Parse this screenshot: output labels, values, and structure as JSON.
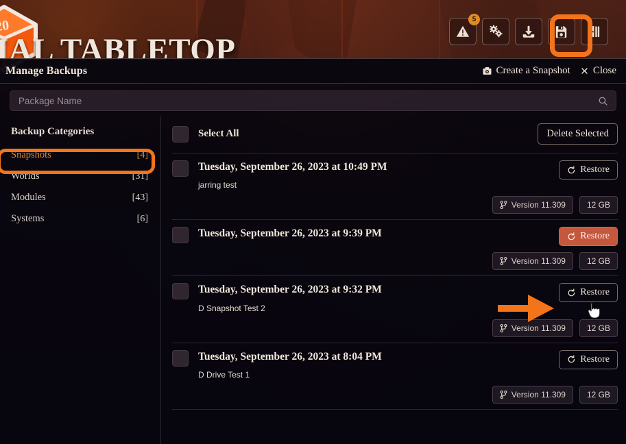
{
  "app": {
    "brand_title": "IAL TABLETOP",
    "logo_icon": "d20-die-icon"
  },
  "toolbar": {
    "items": [
      {
        "name": "warnings-button",
        "icon": "warning-triangle-icon",
        "badge": "5"
      },
      {
        "name": "configuration-button",
        "icon": "gears-icon",
        "badge": ""
      },
      {
        "name": "update-button",
        "icon": "download-icon",
        "badge": ""
      },
      {
        "name": "backups-button",
        "icon": "save-floppy-icon",
        "badge": ""
      },
      {
        "name": "logout-button",
        "icon": "door-exit-icon",
        "badge": ""
      }
    ]
  },
  "dialog": {
    "title": "Manage Backups",
    "create_snapshot_label": "Create a Snapshot",
    "create_snapshot_icon": "camera-icon",
    "close_label": "Close",
    "close_icon": "close-x-icon"
  },
  "search": {
    "placeholder": "Package Name",
    "value": "",
    "icon": "search-icon"
  },
  "sidebar": {
    "heading": "Backup Categories",
    "items": [
      {
        "label": "Snapshots",
        "count": "[4]",
        "active": true
      },
      {
        "label": "Worlds",
        "count": "[31]",
        "active": false
      },
      {
        "label": "Modules",
        "count": "[43]",
        "active": false
      },
      {
        "label": "Systems",
        "count": "[6]",
        "active": false
      }
    ]
  },
  "list_toolbar": {
    "select_all_label": "Select All",
    "delete_selected_label": "Delete Selected"
  },
  "backups": [
    {
      "date": "Tuesday, September 26, 2023 at 10:49 PM",
      "note": "jarring test",
      "restore_label": "Restore",
      "restore_icon": "restore-rotate-icon",
      "version": "Version 11.309",
      "version_icon": "code-branch-icon",
      "size": "12 GB",
      "hovered": false
    },
    {
      "date": "Tuesday, September 26, 2023 at 9:39 PM",
      "note": "",
      "restore_label": "Restore",
      "restore_icon": "restore-rotate-icon",
      "version": "Version 11.309",
      "version_icon": "code-branch-icon",
      "size": "12 GB",
      "hovered": true
    },
    {
      "date": "Tuesday, September 26, 2023 at 9:32 PM",
      "note": "D Snapshot Test 2",
      "restore_label": "Restore",
      "restore_icon": "restore-rotate-icon",
      "version": "Version 11.309",
      "version_icon": "code-branch-icon",
      "size": "12 GB",
      "hovered": false
    },
    {
      "date": "Tuesday, September 26, 2023 at 8:04 PM",
      "note": "D Drive Test 1",
      "restore_label": "Restore",
      "restore_icon": "restore-rotate-icon",
      "version": "Version 11.309",
      "version_icon": "code-branch-icon",
      "size": "12 GB",
      "hovered": false
    }
  ],
  "annotations": {
    "highlight_color": "#f4741a",
    "arrow_color": "#f4741a",
    "targets": [
      "backups-button",
      "sidebar-item-snapshots",
      "restore-button-row-2"
    ]
  },
  "colors": {
    "accent": "#e2872c",
    "hover_button": "#c4573c",
    "text": "#efe3d6",
    "dialog_bg": "#08060e"
  }
}
